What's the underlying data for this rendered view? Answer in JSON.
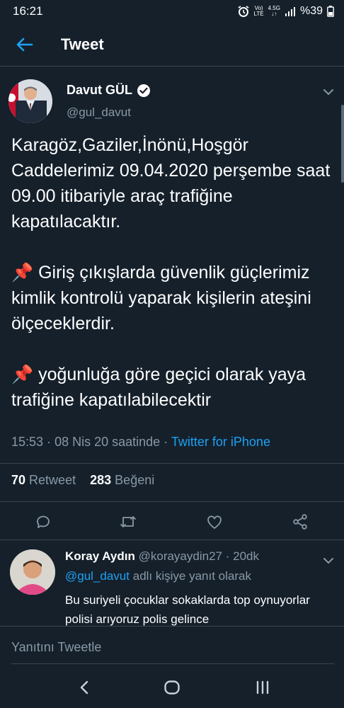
{
  "status_bar": {
    "time": "16:21",
    "network_top": "Vo)",
    "network_bottom": "LTE",
    "data_top": "4.5G",
    "data_bottom": "↓↑",
    "battery": "%39"
  },
  "header": {
    "title": "Tweet"
  },
  "tweet": {
    "author_name": "Davut GÜL",
    "handle": "@gul_davut",
    "text": "Karagöz,Gaziler,İnönü,Hoşgör Caddelerimiz 09.04.2020 perşembe saat 09.00 itibariyle araç trafiğine kapatılacaktır.\n\n📌 Giriş çıkışlarda güvenlik güçlerimiz kimlik kontrolü yaparak kişilerin ateşini ölçeceklerdir.\n\n📌 yoğunluğa göre geçici olarak yaya trafiğine kapatılabilecektir",
    "time": "15:53",
    "date": "08 Nis 20 saatinde",
    "separator": "·",
    "source": "Twitter for iPhone",
    "retweet_count": "70",
    "retweet_label": "Retweet",
    "like_count": "283",
    "like_label": "Beğeni"
  },
  "reply": {
    "name": "Koray Aydın",
    "handle": "@korayaydin27",
    "separator": "·",
    "time": "20dk",
    "reply_to_handle": "@gul_davut",
    "reply_to_suffix": "adlı kişiye yanıt olarak",
    "text": "Bu suriyeli çocuklar sokaklarda top oynuyorlar polisi arıyoruz polis gelince"
  },
  "compose": {
    "placeholder": "Yanıtını Tweetle"
  },
  "colors": {
    "background": "#15202b",
    "accent": "#1da1f2",
    "muted": "#8899a6",
    "divider": "#38444d"
  }
}
